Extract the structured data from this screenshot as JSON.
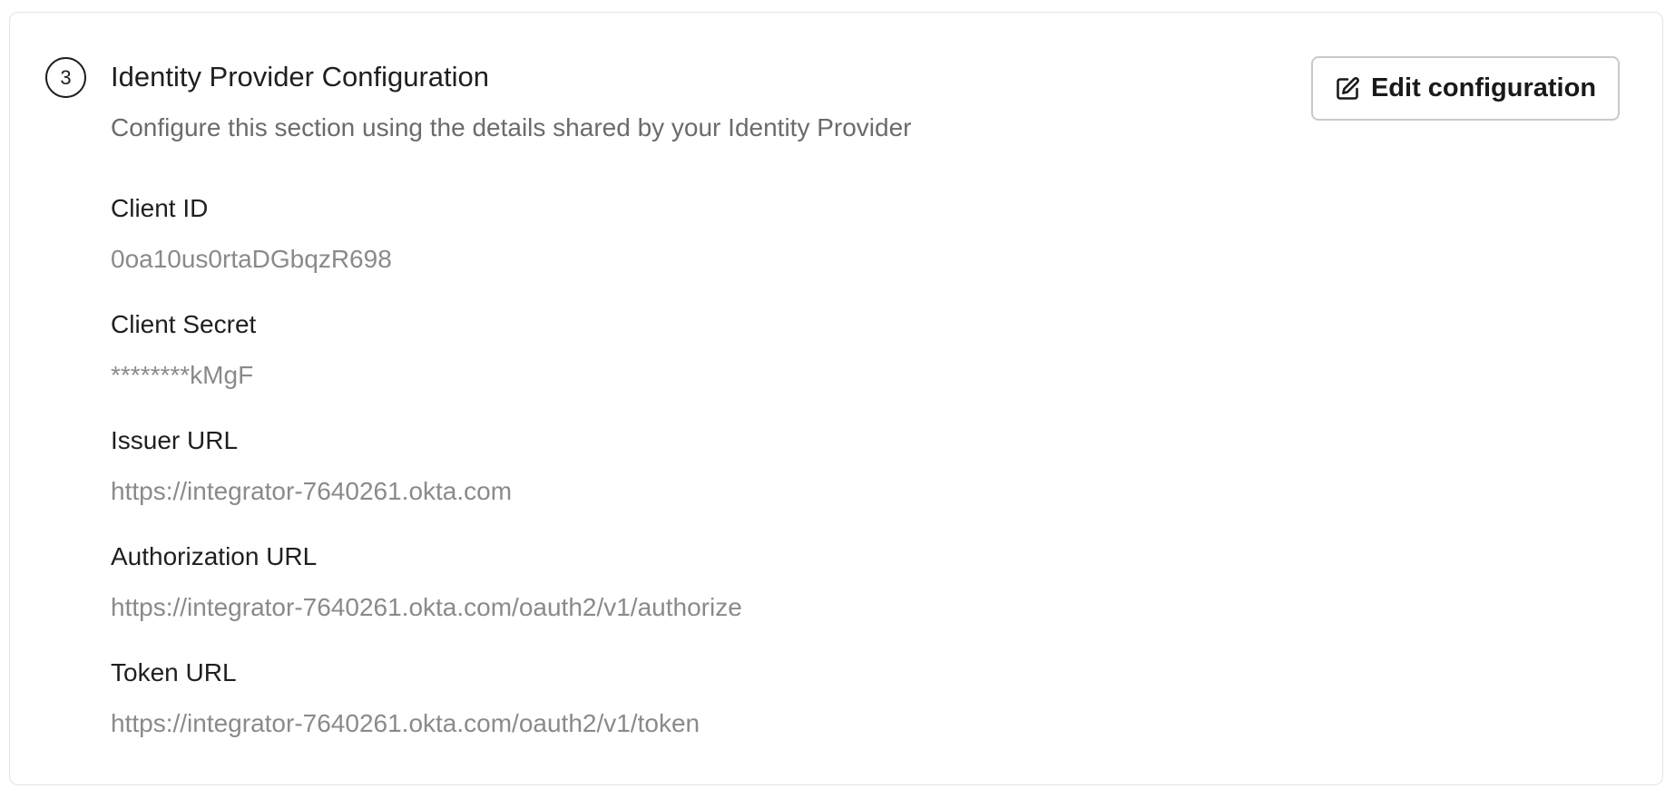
{
  "section": {
    "step_number": "3",
    "title": "Identity Provider Configuration",
    "subtitle": "Configure this section using the details shared by your Identity Provider",
    "edit_button": {
      "label": "Edit configuration",
      "icon": "edit-icon"
    }
  },
  "fields": [
    {
      "label": "Client ID",
      "value": "0oa10us0rtaDGbqzR698"
    },
    {
      "label": "Client Secret",
      "value": "********kMgF"
    },
    {
      "label": "Issuer URL",
      "value": "https://integrator-7640261.okta.com"
    },
    {
      "label": "Authorization URL",
      "value": "https://integrator-7640261.okta.com/oauth2/v1/authorize"
    },
    {
      "label": "Token URL",
      "value": "https://integrator-7640261.okta.com/oauth2/v1/token"
    }
  ]
}
